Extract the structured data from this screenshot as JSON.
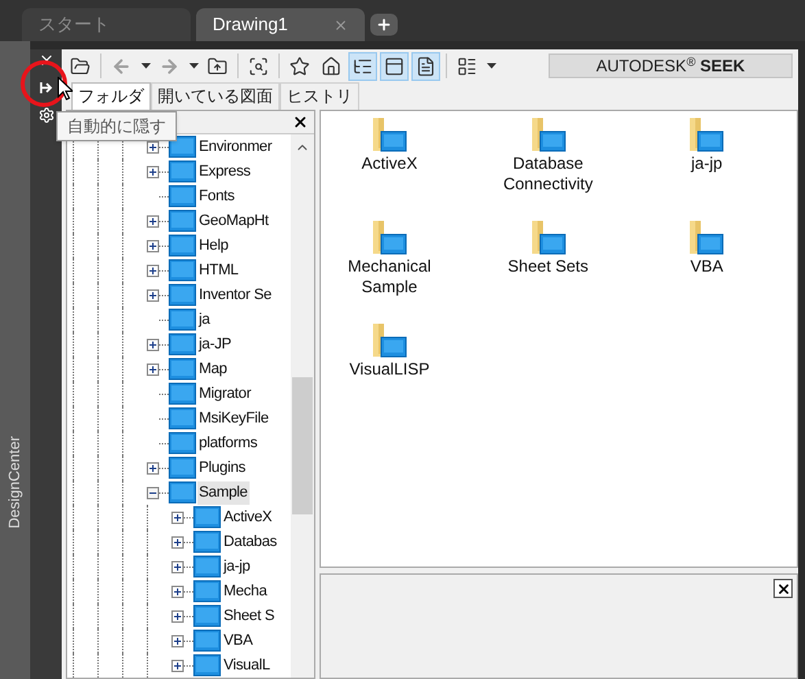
{
  "tabs": [
    {
      "label": "スタート",
      "selected": false
    },
    {
      "label": "Drawing1",
      "selected": true
    }
  ],
  "palette": {
    "title": "DesignCenter",
    "tooltip": "自動的に隠す"
  },
  "toolbar": [
    {
      "pressed": false,
      "disabled": false
    },
    {
      "pressed": false,
      "disabled": true
    },
    {
      "pressed": false,
      "disabled": false
    },
    {
      "pressed": false,
      "disabled": true
    },
    {
      "pressed": false,
      "disabled": false
    },
    {
      "pressed": false,
      "disabled": false
    },
    {
      "pressed": false,
      "disabled": false
    },
    {
      "pressed": false,
      "disabled": false
    },
    {
      "pressed": false,
      "disabled": false
    },
    {
      "pressed": true,
      "disabled": false
    },
    {
      "pressed": true,
      "disabled": false
    },
    {
      "pressed": true,
      "disabled": false
    },
    {
      "pressed": false,
      "disabled": false
    },
    {
      "pressed": false,
      "disabled": false
    }
  ],
  "seek_button": "AUTODESK$^{®}$ **SEEK**",
  "view_tabs": [
    {
      "label": "フォルダ",
      "selected": true
    },
    {
      "label": "開いている図面",
      "selected": false
    },
    {
      "label": "ヒストリ",
      "selected": false
    }
  ],
  "tree": [
    {
      "label": "Environmer",
      "expandable": true,
      "expanded": false,
      "selected": false
    },
    {
      "label": "Express",
      "expandable": true,
      "expanded": false,
      "selected": false
    },
    {
      "label": "Fonts",
      "expandable": false,
      "selected": false
    },
    {
      "label": "GeoMapHt",
      "expandable": true,
      "expanded": false,
      "selected": false
    },
    {
      "label": "Help",
      "expandable": true,
      "expanded": false,
      "selected": false
    },
    {
      "label": "HTML",
      "expandable": true,
      "expanded": false,
      "selected": false
    },
    {
      "label": "Inventor Se",
      "expandable": true,
      "expanded": false,
      "selected": false
    },
    {
      "label": "ja",
      "expandable": false,
      "selected": false
    },
    {
      "label": "ja-JP",
      "expandable": true,
      "expanded": false,
      "selected": false
    },
    {
      "label": "Map",
      "expandable": true,
      "expanded": false,
      "selected": false
    },
    {
      "label": "Migrator",
      "expandable": false,
      "selected": false
    },
    {
      "label": "MsiKeyFile",
      "expandable": false,
      "selected": false
    },
    {
      "label": "platforms",
      "expandable": false,
      "selected": false
    },
    {
      "label": "Plugins",
      "expandable": true,
      "expanded": false,
      "selected": false
    },
    {
      "label": "Sample",
      "expandable": true,
      "expanded": true,
      "selected": true,
      "children": [
        {
          "label": "ActiveX",
          "expandable": true,
          "expanded": false,
          "selected": false
        },
        {
          "label": "Databas",
          "expandable": true,
          "expanded": false,
          "selected": false
        },
        {
          "label": "ja-jp",
          "expandable": true,
          "expanded": false,
          "selected": false
        },
        {
          "label": "Mecha",
          "expandable": true,
          "expanded": false,
          "selected": false
        },
        {
          "label": "Sheet S",
          "expandable": true,
          "expanded": false,
          "selected": false
        },
        {
          "label": "VBA",
          "expandable": true,
          "expanded": false,
          "selected": false
        },
        {
          "label": "VisualL",
          "expandable": true,
          "expanded": false,
          "selected": false
        }
      ]
    }
  ],
  "content": [
    {
      "label": "ActiveX"
    },
    {
      "label": "Database Connectivity"
    },
    {
      "label": "ja-jp"
    },
    {
      "label": "Mechanical Sample"
    },
    {
      "label": "Sheet Sets"
    },
    {
      "label": "VBA"
    },
    {
      "label": "VisualLISP"
    }
  ]
}
